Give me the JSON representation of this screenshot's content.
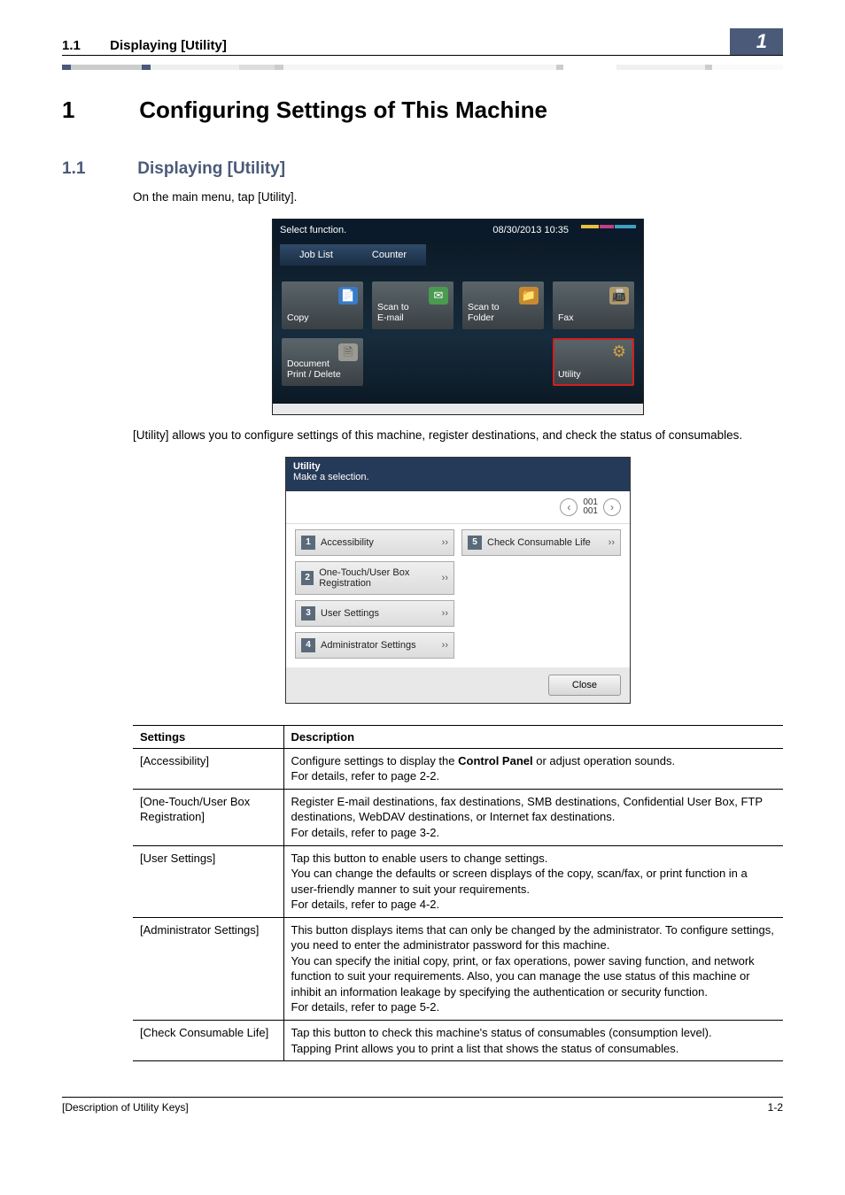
{
  "header": {
    "section_no": "1.1",
    "section_title": "Displaying [Utility]",
    "chapter_badge": "1"
  },
  "chapter": {
    "number": "1",
    "title": "Configuring Settings of This Machine"
  },
  "section": {
    "number": "1.1",
    "title": "Displaying [Utility]"
  },
  "intro_para": "On the main menu, tap [Utility].",
  "screenshot1": {
    "prompt": "Select function.",
    "datetime": "08/30/2013 10:35",
    "tabs": [
      "Job List",
      "Counter"
    ],
    "tiles": [
      {
        "label": "Copy",
        "icon_name": "copy-icon",
        "icon_cls": "ic-blue",
        "glyph": "📄"
      },
      {
        "label": "Scan to\nE-mail",
        "icon_name": "email-icon",
        "icon_cls": "ic-green",
        "glyph": "✉"
      },
      {
        "label": "Scan to\nFolder",
        "icon_name": "folder-icon",
        "icon_cls": "ic-orange",
        "glyph": "📁"
      },
      {
        "label": "Fax",
        "icon_name": "fax-icon",
        "icon_cls": "ic-tan",
        "glyph": "📠"
      },
      {
        "label": "Document\nPrint / Delete",
        "icon_name": "document-icon",
        "icon_cls": "ic-gray",
        "glyph": "🗎"
      },
      {
        "label": "",
        "empty": true
      },
      {
        "label": "",
        "empty": true
      },
      {
        "label": "Utility",
        "icon_name": "gear-icon",
        "icon_cls": "ic-gear",
        "glyph": "⚙",
        "highlight": true
      }
    ]
  },
  "mid_para": "[Utility] allows you to configure settings of this machine, register destinations, and check the status of consumables.",
  "screenshot2": {
    "title": "Utility",
    "subtitle": "Make a selection.",
    "page_ind": "001\n001",
    "items": [
      {
        "num": "1",
        "label": "Accessibility"
      },
      {
        "num": "2",
        "label": "One-Touch/User Box Registration"
      },
      {
        "num": "3",
        "label": "User Settings"
      },
      {
        "num": "4",
        "label": "Administrator Settings"
      },
      {
        "num": "5",
        "label": "Check Consumable Life"
      }
    ],
    "close_label": "Close"
  },
  "table": {
    "head": {
      "col1": "Settings",
      "col2": "Description"
    },
    "rows": [
      {
        "setting": "[Accessibility]",
        "desc_pre": "Configure settings to display the ",
        "desc_bold": "Control Panel",
        "desc_post": " or adjust operation sounds.\nFor details, refer to page 2-2."
      },
      {
        "setting": "[One-Touch/User Box Registration]",
        "desc": "Register E-mail destinations, fax destinations, SMB destinations, Confidential User Box, FTP destinations, WebDAV destinations, or Internet fax destinations.\nFor details, refer to page 3-2."
      },
      {
        "setting": "[User Settings]",
        "desc": "Tap this button to enable users to change settings.\nYou can change the defaults or screen displays of the copy, scan/fax, or print function in a user-friendly manner to suit your requirements.\nFor details, refer to page 4-2."
      },
      {
        "setting": "[Administrator Settings]",
        "desc": "This button displays items that can only be changed by the administrator. To configure settings, you need to enter the administrator password for this machine.\nYou can specify the initial copy, print, or fax operations, power saving function, and network function to suit your requirements. Also, you can manage the use status of this machine or inhibit an information leakage by specifying the authentication or security function.\nFor details, refer to page 5-2."
      },
      {
        "setting": "[Check Consumable Life]",
        "desc": "Tap this button to check this machine's status of consumables (consumption level).\nTapping Print allows you to print a list that shows the status of consumables."
      }
    ]
  },
  "footer": {
    "left": "[Description of Utility Keys]",
    "right": "1-2"
  }
}
